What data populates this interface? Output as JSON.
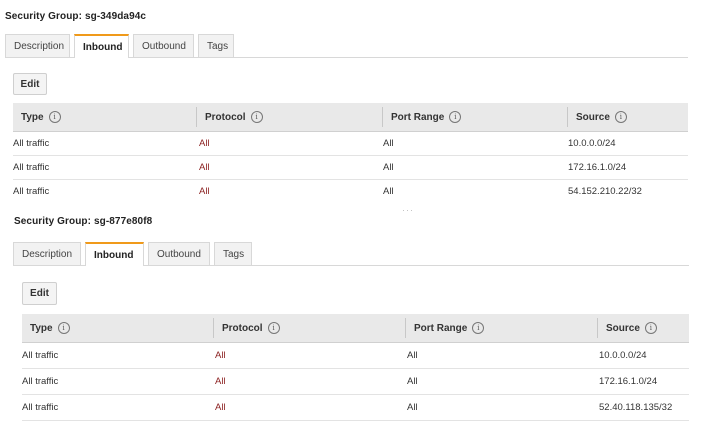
{
  "panels": [
    {
      "title": "Security Group: sg-349da94c",
      "tabs": [
        "Description",
        "Inbound",
        "Outbound",
        "Tags"
      ],
      "active_tab": "Inbound",
      "edit_label": "Edit",
      "columns": [
        "Type",
        "Protocol",
        "Port Range",
        "Source"
      ],
      "rows": [
        {
          "type": "All traffic",
          "protocol": "All",
          "port_range": "All",
          "source": "10.0.0.0/24"
        },
        {
          "type": "All traffic",
          "protocol": "All",
          "port_range": "All",
          "source": "172.16.1.0/24"
        },
        {
          "type": "All traffic",
          "protocol": "All",
          "port_range": "All",
          "source": "54.152.210.22/32"
        }
      ]
    },
    {
      "title": "Security Group: sg-877e80f8",
      "tabs": [
        "Description",
        "Inbound",
        "Outbound",
        "Tags"
      ],
      "active_tab": "Inbound",
      "edit_label": "Edit",
      "columns": [
        "Type",
        "Protocol",
        "Port Range",
        "Source"
      ],
      "rows": [
        {
          "type": "All traffic",
          "protocol": "All",
          "port_range": "All",
          "source": "10.0.0.0/24"
        },
        {
          "type": "All traffic",
          "protocol": "All",
          "port_range": "All",
          "source": "172.16.1.0/24"
        },
        {
          "type": "All traffic",
          "protocol": "All",
          "port_range": "All",
          "source": "52.40.118.135/32"
        }
      ]
    }
  ],
  "icons": {
    "info": "info-icon"
  },
  "colors": {
    "active_tab_accent": "#f09a1a",
    "protocol_text": "#8b1f1f",
    "header_bg": "#e9e9e9"
  }
}
